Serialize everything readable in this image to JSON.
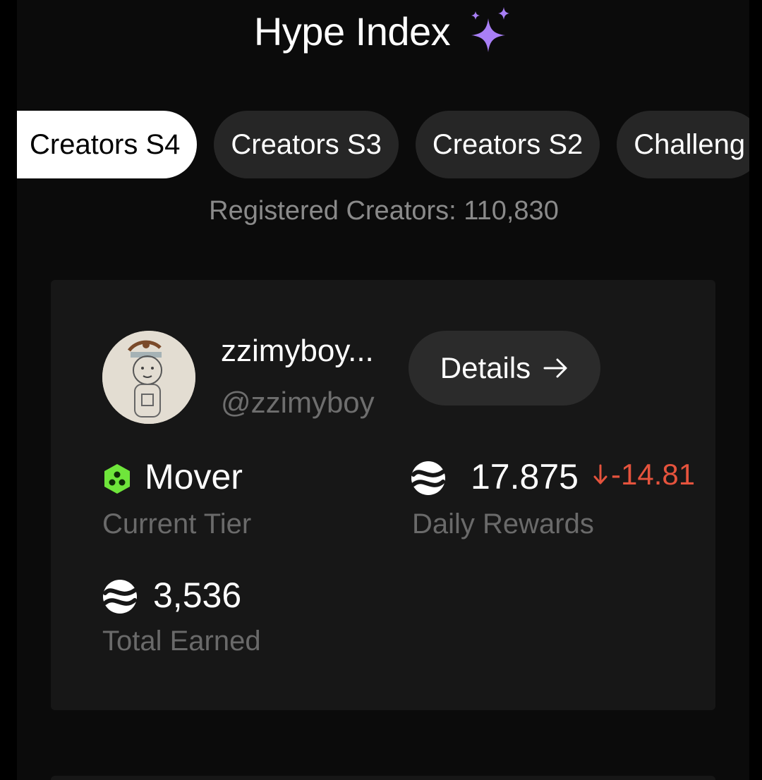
{
  "header": {
    "title": "Hype Index",
    "title_icon": "sparkle-icon"
  },
  "tabs": [
    {
      "label": "Creators S4",
      "active": true
    },
    {
      "label": "Creators S3",
      "active": false
    },
    {
      "label": "Creators S2",
      "active": false
    },
    {
      "label": "Challeng",
      "active": false
    }
  ],
  "registered_text": "Registered Creators: 110,830",
  "profile": {
    "display_name": "zzimyboy...",
    "handle": "@zzimyboy",
    "details_label": "Details",
    "details_icon": "arrow-right-icon"
  },
  "stats": {
    "tier_value": "Mover",
    "tier_label": "Current Tier",
    "daily_value": "17.875",
    "daily_delta": "-14.81",
    "daily_delta_icon": "arrow-down-icon",
    "daily_label": "Daily Rewards",
    "total_value": "3,536",
    "total_label": "Total Earned"
  },
  "colors": {
    "accent_sparkle": "#a87ff5",
    "negative": "#e5533d",
    "tier_green": "#6fe53b"
  }
}
